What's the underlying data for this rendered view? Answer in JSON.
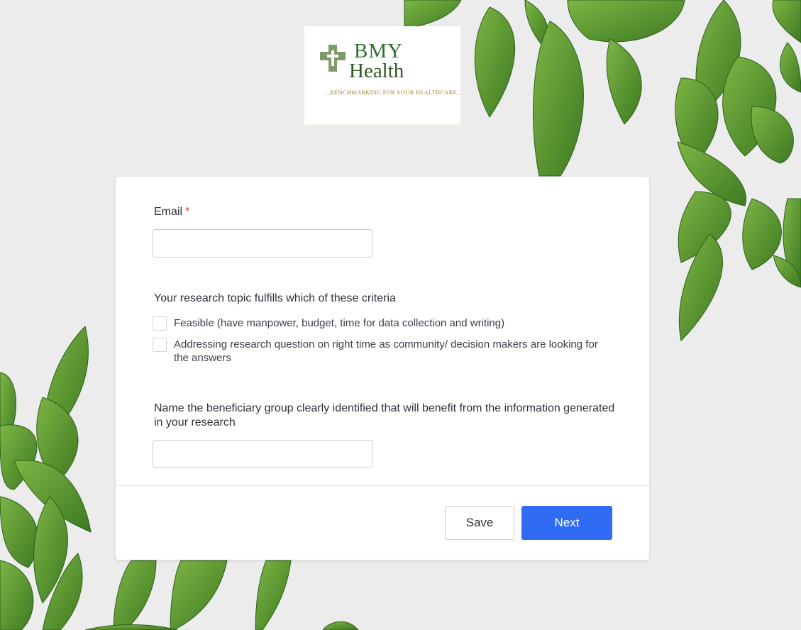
{
  "logo": {
    "line1": "BMY",
    "line2": "Health",
    "tagline": "_BENCHMARKING FOR YOUR HEALTHCARE_"
  },
  "form": {
    "email": {
      "label": "Email",
      "required_mark": "*",
      "value": ""
    },
    "criteria": {
      "label": "Your research topic fulfills which of these criteria",
      "options": [
        "Feasible (have manpower, budget, time for data collection and writing)",
        "Addressing research question on right time as community/ decision makers are looking for the answers"
      ]
    },
    "beneficiary": {
      "label": "Name the beneficiary group clearly identified that will benefit from the information generated in your research",
      "value": ""
    }
  },
  "actions": {
    "save_label": "Save",
    "next_label": "Next"
  },
  "colors": {
    "background": "#ececec",
    "primary": "#2f6bf3",
    "required": "#d23b3b",
    "leaf": "#4f8a2a"
  }
}
